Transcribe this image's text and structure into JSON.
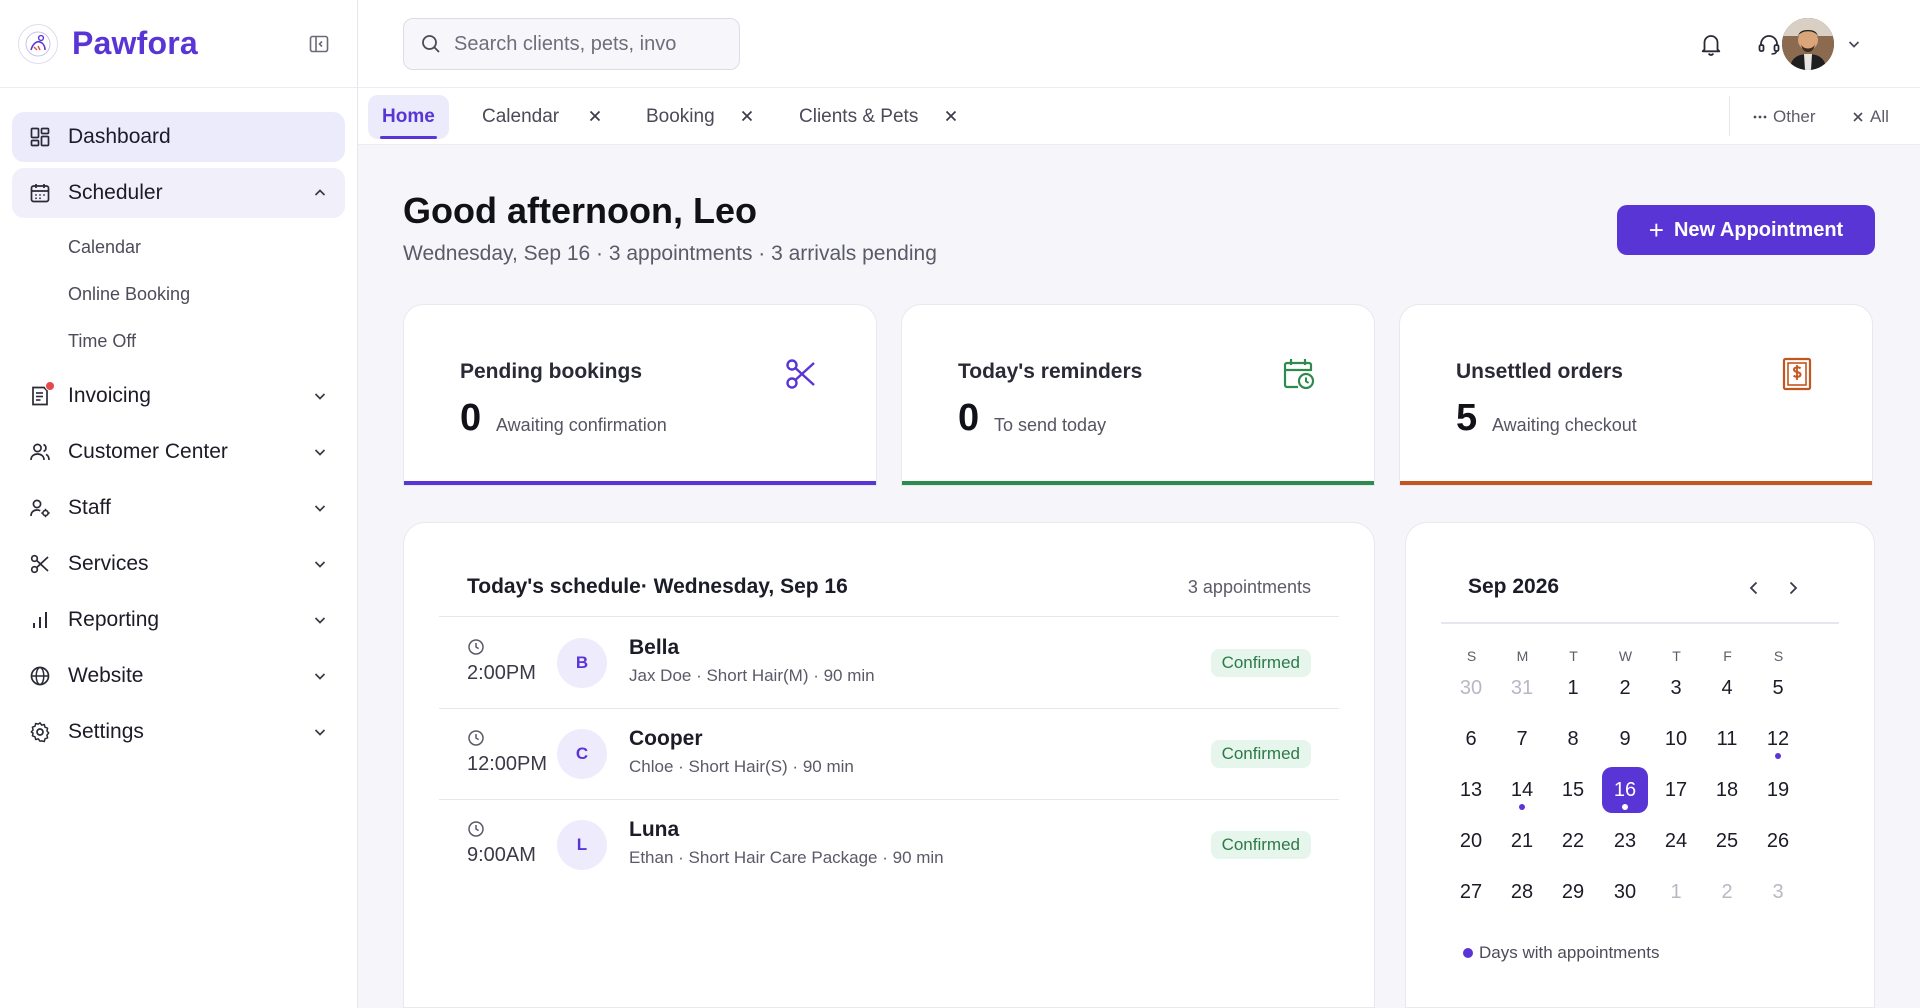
{
  "brand": {
    "name": "Pawfora",
    "accent": "#5a35d6"
  },
  "sidebar": {
    "items": [
      {
        "id": "dashboard",
        "label": "Dashboard",
        "icon": "dashboard-icon",
        "active": true
      },
      {
        "id": "scheduler",
        "label": "Scheduler",
        "icon": "calendar-icon",
        "expanded": true,
        "children": [
          "Calendar",
          "Online Booking",
          "Time Off"
        ]
      },
      {
        "id": "invoicing",
        "label": "Invoicing",
        "icon": "invoice-icon",
        "badge": true
      },
      {
        "id": "customer-center",
        "label": "Customer Center",
        "icon": "users-icon"
      },
      {
        "id": "staff",
        "label": "Staff",
        "icon": "staff-icon"
      },
      {
        "id": "services",
        "label": "Services",
        "icon": "scissors-icon"
      },
      {
        "id": "reporting",
        "label": "Reporting",
        "icon": "bar-chart-icon"
      },
      {
        "id": "website",
        "label": "Website",
        "icon": "globe-icon"
      },
      {
        "id": "settings",
        "label": "Settings",
        "icon": "gear-icon"
      }
    ]
  },
  "topbar": {
    "search_placeholder": "Search clients, pets, invo",
    "icons": [
      "bell-icon",
      "headset-icon",
      "avatar",
      "chevron-down-icon"
    ]
  },
  "tabs": {
    "items": [
      {
        "label": "Home",
        "active": true,
        "closable": false
      },
      {
        "label": "Calendar",
        "closable": true
      },
      {
        "label": "Booking",
        "closable": true
      },
      {
        "label": "Clients & Pets",
        "closable": true
      }
    ],
    "other_label": "Other",
    "all_label": "All"
  },
  "main": {
    "greeting": "Good afternoon, Leo",
    "subline": "Wednesday, Sep 16 · 3 appointments · 3 arrivals pending",
    "new_appointment_label": "New Appointment"
  },
  "stats": [
    {
      "title": "Pending bookings",
      "value": "0",
      "desc": "Awaiting confirmation",
      "icon": "scissors-icon",
      "color": "#5a35d6"
    },
    {
      "title": "Today's reminders",
      "value": "0",
      "desc": "To send today",
      "icon": "calendar-clock-icon",
      "color": "#2f8a4e"
    },
    {
      "title": "Unsettled orders",
      "value": "5",
      "desc": "Awaiting checkout",
      "icon": "invoice-dollar-icon",
      "color": "#c2561e"
    }
  ],
  "schedule": {
    "title": "Today's schedule· Wednesday, Sep 16",
    "count": "3 appointments",
    "rows": [
      {
        "time": "2:00PM",
        "initial": "B",
        "pet": "Bella",
        "info": "Jax Doe · Short Hair(M) · 90 min",
        "status": "Confirmed"
      },
      {
        "time": "12:00PM",
        "initial": "C",
        "pet": "Cooper",
        "info": "Chloe · Short Hair(S) · 90 min",
        "status": "Confirmed"
      },
      {
        "time": "9:00AM",
        "initial": "L",
        "pet": "Luna",
        "info": "Ethan · Short Hair Care Package · 90 min",
        "status": "Confirmed"
      }
    ]
  },
  "calendar": {
    "month_label": "Sep 2026",
    "weekdays": [
      "S",
      "M",
      "T",
      "W",
      "T",
      "F",
      "S"
    ],
    "weeks": [
      [
        {
          "d": "30",
          "muted": true
        },
        {
          "d": "31",
          "muted": true
        },
        {
          "d": "1"
        },
        {
          "d": "2"
        },
        {
          "d": "3"
        },
        {
          "d": "4"
        },
        {
          "d": "5"
        }
      ],
      [
        {
          "d": "6"
        },
        {
          "d": "7"
        },
        {
          "d": "8"
        },
        {
          "d": "9"
        },
        {
          "d": "10"
        },
        {
          "d": "11"
        },
        {
          "d": "12",
          "dot": true
        }
      ],
      [
        {
          "d": "13"
        },
        {
          "d": "14",
          "dot": true
        },
        {
          "d": "15"
        },
        {
          "d": "16",
          "selected": true,
          "dot": true
        },
        {
          "d": "17"
        },
        {
          "d": "18"
        },
        {
          "d": "19"
        }
      ],
      [
        {
          "d": "20"
        },
        {
          "d": "21"
        },
        {
          "d": "22"
        },
        {
          "d": "23"
        },
        {
          "d": "24"
        },
        {
          "d": "25"
        },
        {
          "d": "26"
        }
      ],
      [
        {
          "d": "27"
        },
        {
          "d": "28"
        },
        {
          "d": "29"
        },
        {
          "d": "30"
        },
        {
          "d": "1",
          "muted": true
        },
        {
          "d": "2",
          "muted": true
        },
        {
          "d": "3",
          "muted": true
        }
      ]
    ],
    "legend": "Days with appointments"
  }
}
